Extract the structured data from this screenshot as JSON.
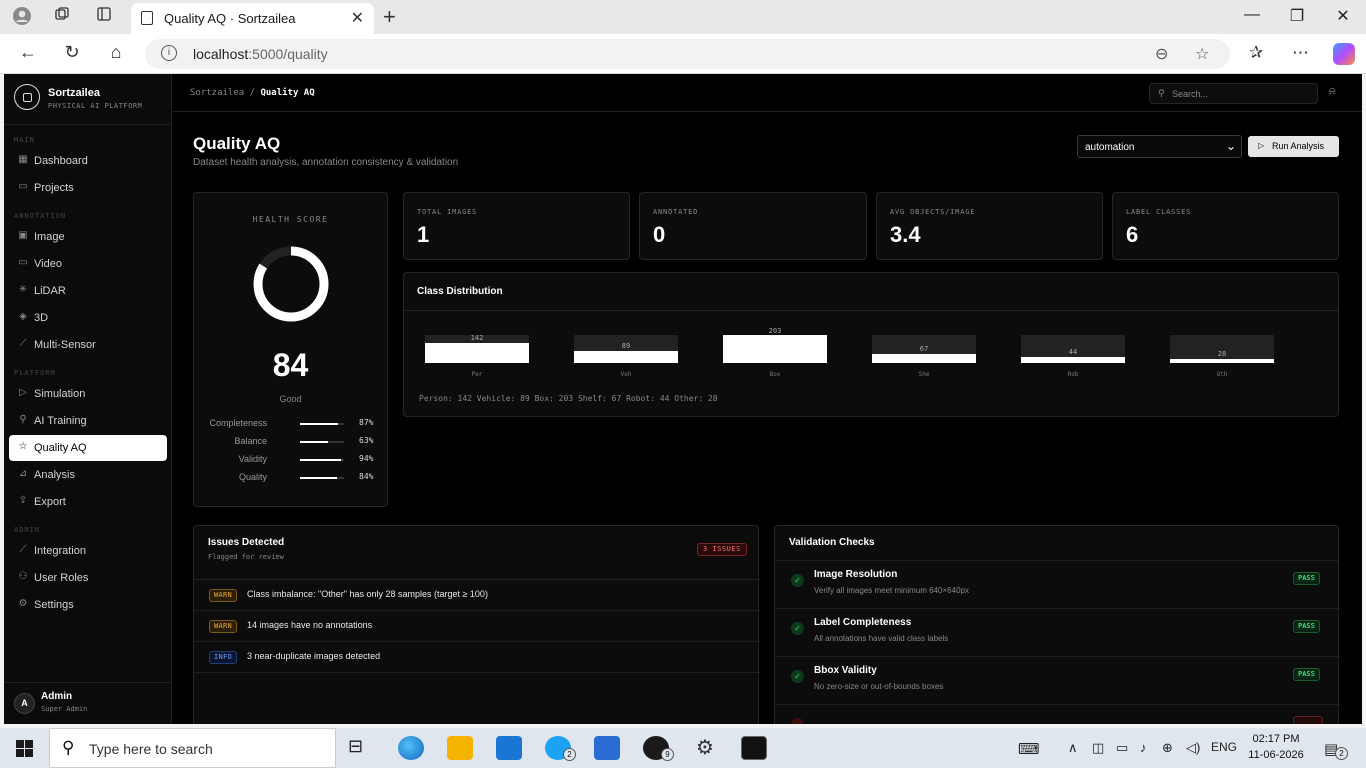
{
  "browser": {
    "tab_title": "Quality AQ · Sortzailea",
    "url_host": "localhost",
    "url_path": ":5000/quality"
  },
  "sidebar": {
    "brand_name": "Sortzailea",
    "brand_sub": "PHYSICAL AI PLATFORM",
    "sections": {
      "main": "MAIN",
      "annotation": "ANNOTATION",
      "platform": "PLATFORM",
      "admin": "ADMIN"
    },
    "items": [
      {
        "label": "Dashboard",
        "icon": "grid-icon"
      },
      {
        "label": "Projects",
        "icon": "folder-icon"
      },
      {
        "label": "Image",
        "icon": "image-icon"
      },
      {
        "label": "Video",
        "icon": "video-icon"
      },
      {
        "label": "LiDAR",
        "icon": "lidar-icon"
      },
      {
        "label": "3D",
        "icon": "cube-icon"
      },
      {
        "label": "Multi-Sensor",
        "icon": "sensor-icon"
      },
      {
        "label": "Simulation",
        "icon": "play-icon"
      },
      {
        "label": "AI Training",
        "icon": "ai-icon"
      },
      {
        "label": "Quality AQ",
        "icon": "star-icon"
      },
      {
        "label": "Analysis",
        "icon": "chart-icon"
      },
      {
        "label": "Export",
        "icon": "export-icon"
      },
      {
        "label": "Integration",
        "icon": "link-icon"
      },
      {
        "label": "User Roles",
        "icon": "users-icon"
      },
      {
        "label": "Settings",
        "icon": "gear-icon"
      }
    ],
    "user": {
      "initial": "A",
      "name": "Admin",
      "role": "Super Admin"
    }
  },
  "topbar": {
    "crumb_root": "Sortzailea",
    "crumb_sep": "/",
    "crumb_current": "Quality AQ",
    "search_placeholder": "Search..."
  },
  "header": {
    "title": "Quality AQ",
    "subtitle": "Dataset health analysis, annotation consistency & validation",
    "project_select": "automation",
    "run_label": "Run Analysis"
  },
  "health": {
    "label": "HEALTH SCORE",
    "score": "84",
    "score_fraction": 0.84,
    "grade": "Good",
    "metrics": [
      {
        "name": "Completeness",
        "value": "87%",
        "fraction": 0.87
      },
      {
        "name": "Balance",
        "value": "63%",
        "fraction": 0.63
      },
      {
        "name": "Validity",
        "value": "94%",
        "fraction": 0.94
      },
      {
        "name": "Quality",
        "value": "84%",
        "fraction": 0.84
      }
    ]
  },
  "stats": [
    {
      "label": "TOTAL IMAGES",
      "value": "1"
    },
    {
      "label": "ANNOTATED",
      "value": "0"
    },
    {
      "label": "AVG OBJECTS/IMAGE",
      "value": "3.4"
    },
    {
      "label": "LABEL CLASSES",
      "value": "6"
    }
  ],
  "distribution": {
    "title": "Class Distribution",
    "summary": "Person: 142 Vehicle: 89 Box: 203 Shelf: 67 Robot: 44 Other: 28"
  },
  "chart_data": {
    "type": "bar",
    "categories": [
      "Per",
      "Veh",
      "Box",
      "She",
      "Rob",
      "Oth"
    ],
    "values": [
      142,
      89,
      203,
      67,
      44,
      28
    ],
    "ylim": [
      0,
      203
    ],
    "grid": false,
    "legend": "none"
  },
  "issues": {
    "title": "Issues Detected",
    "subtitle": "Flagged for review",
    "badge": "3 ISSUES",
    "items": [
      {
        "level": "WARN",
        "text": "Class imbalance: \"Other\" has only 28 samples (target ≥ 100)"
      },
      {
        "level": "WARN",
        "text": "14 images have no annotations"
      },
      {
        "level": "INFO",
        "text": "3 near-duplicate images detected"
      }
    ]
  },
  "checks": {
    "title": "Validation Checks",
    "items": [
      {
        "name": "Image Resolution",
        "desc": "Verify all images meet minimum 640×640px",
        "status": "PASS"
      },
      {
        "name": "Label Completeness",
        "desc": "All annotations have valid class labels",
        "status": "PASS"
      },
      {
        "name": "Bbox Validity",
        "desc": "No zero-size or out-of-bounds boxes",
        "status": "PASS"
      }
    ]
  },
  "taskbar": {
    "search_placeholder": "Type here to search",
    "twitter_badge": "2",
    "whatsapp_badge": "9",
    "lang": "ENG",
    "time": "02:17 PM",
    "date": "11-06-2026",
    "notif_count": "2"
  },
  "colors": {
    "app_bg": "#000000",
    "accent": "#ffffff",
    "warn": "#f0a93b",
    "info": "#6a9cff",
    "pass": "#3ddc72",
    "danger": "#ff6b6b"
  }
}
